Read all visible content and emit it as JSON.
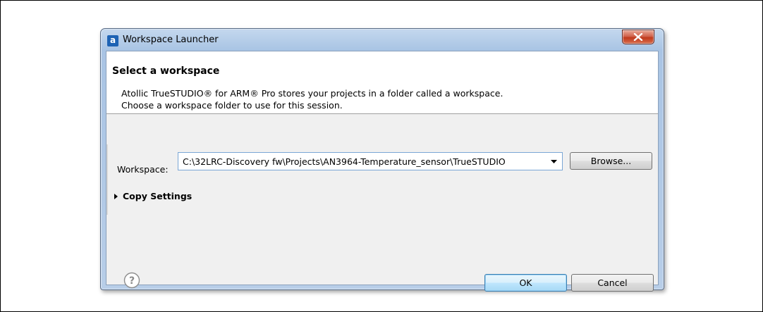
{
  "window": {
    "title": "Workspace Launcher",
    "app_icon_glyph": "a"
  },
  "header": {
    "title": "Select a workspace",
    "description_line1": "Atollic TrueSTUDIO® for ARM® Pro stores your projects in a folder called a workspace.",
    "description_line2": "Choose a workspace folder to use for this session."
  },
  "workspace": {
    "label": "Workspace:",
    "value": "C:\\32LRC-Discovery fw\\Projects\\AN3964-Temperature_sensor\\TrueSTUDIO"
  },
  "buttons": {
    "browse": "Browse...",
    "ok": "OK",
    "cancel": "Cancel"
  },
  "copy_settings": {
    "label": "Copy Settings"
  },
  "icons": {
    "help": "help-icon",
    "close": "close-icon",
    "dropdown": "chevron-down-icon",
    "expand": "triangle-right-icon"
  },
  "colors": {
    "close_button": "#c0391c",
    "focus_border": "#3c7fb1",
    "window_frame": "#a9c4e4"
  }
}
